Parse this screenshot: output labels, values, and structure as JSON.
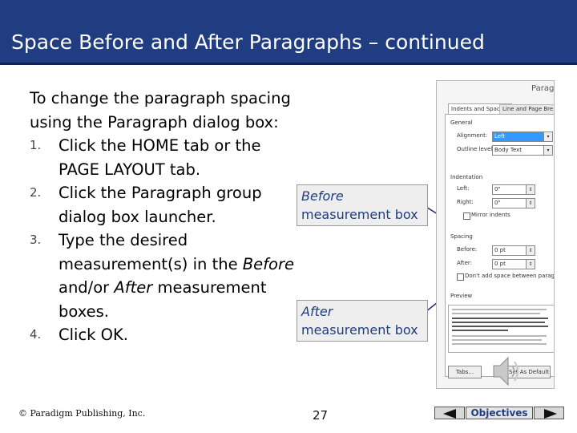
{
  "slide": {
    "title": "Space Before and After Paragraphs – continued",
    "intro": "To change the paragraph spacing using the Paragraph dialog box:",
    "steps": [
      {
        "num": "1.",
        "text": "Click the HOME tab or the PAGE LAYOUT tab."
      },
      {
        "num": "2.",
        "text": "Click the Paragraph group dialog box launcher."
      },
      {
        "num": "3.",
        "pre": "Type the desired measurement(s) in the ",
        "em1": "Before",
        "mid": " and/or ",
        "em2": "After",
        "post": " measurement boxes."
      },
      {
        "num": "4.",
        "text": "Click OK."
      }
    ],
    "callouts": {
      "before": {
        "em": "Before",
        "rest": "measurement box"
      },
      "after": {
        "em": "After",
        "rest": "measurement box"
      }
    }
  },
  "dialog": {
    "title": "Parag",
    "tabs": [
      "Indents and Spacing",
      "Line and Page Bre"
    ],
    "general": {
      "label": "General",
      "alignment_label": "Alignment:",
      "alignment_value": "Left",
      "outline_label": "Outline level:",
      "outline_value": "Body Text"
    },
    "indentation": {
      "label": "Indentation",
      "left_label": "Left:",
      "left_value": "0\"",
      "right_label": "Right:",
      "right_value": "0\"",
      "mirror_label": "Mirror indents"
    },
    "spacing": {
      "label": "Spacing",
      "before_label": "Before:",
      "before_value": "0 pt",
      "after_label": "After:",
      "after_value": "0 pt",
      "dont_add_label": "Don't add space between paragrapl"
    },
    "preview_label": "Preview",
    "tabs_button": "Tabs...",
    "default_button": "Set As Default"
  },
  "footer": {
    "copyright": "© Paradigm Publishing, Inc.",
    "page_number": "27",
    "nav_objectives": "Objectives"
  },
  "colors": {
    "title_bg": "#1f3d80",
    "callout_text": "#1f3d80",
    "connector": "#1a2a6a"
  },
  "icons": [
    "speaker-icon",
    "prev-arrow-icon",
    "next-arrow-icon"
  ]
}
